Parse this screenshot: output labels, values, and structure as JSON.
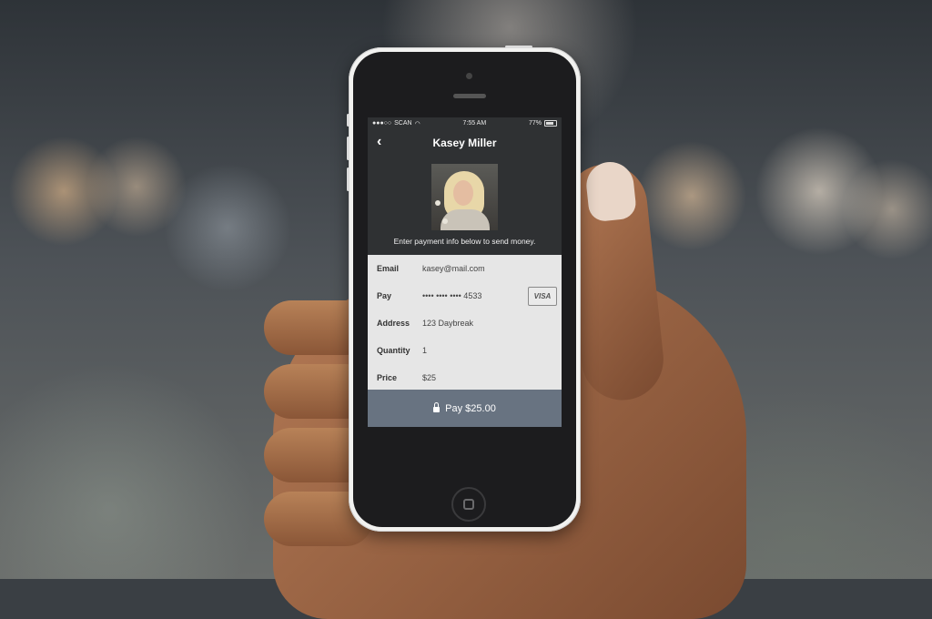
{
  "status_bar": {
    "carrier": "SCAN",
    "signal_icon": "signal-dots-icon",
    "wifi_icon": "wifi-icon",
    "time": "7:55 AM",
    "battery": "77%",
    "battery_icon": "battery-icon"
  },
  "nav": {
    "back_icon": "chevron-left-icon",
    "back_glyph": "‹",
    "title": "Kasey Miller"
  },
  "profile": {
    "subtitle": "Enter payment info below to send money."
  },
  "form": {
    "rows": [
      {
        "label": "Email",
        "value": "kasey@mail.com"
      },
      {
        "label": "Pay",
        "value": "•••• •••• •••• 4533"
      },
      {
        "label": "Address",
        "value": "123 Daybreak"
      },
      {
        "label": "Quantity",
        "value": "1"
      },
      {
        "label": "Price",
        "value": "$25"
      }
    ],
    "card_brand": "VISA"
  },
  "pay_button": {
    "icon": "lock-icon",
    "label": "Pay $25.00"
  },
  "colors": {
    "screen_bg": "#2f3133",
    "form_bg": "#e6e6e6",
    "pay_button_bg": "#687381"
  }
}
